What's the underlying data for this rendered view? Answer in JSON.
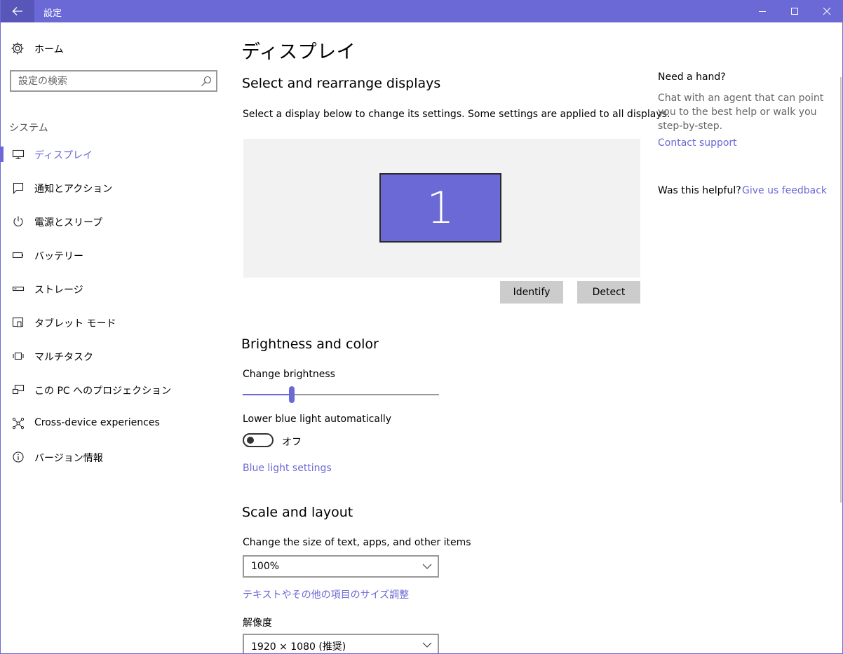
{
  "titlebar": {
    "title": "設定"
  },
  "sidebar": {
    "home_label": "ホーム",
    "search_placeholder": "設定の検索",
    "section_label": "システム",
    "items": [
      {
        "label": "ディスプレイ",
        "icon": "monitor-icon",
        "active": true
      },
      {
        "label": "通知とアクション",
        "icon": "message-icon",
        "active": false
      },
      {
        "label": "電源とスリープ",
        "icon": "power-icon",
        "active": false
      },
      {
        "label": "バッテリー",
        "icon": "battery-icon",
        "active": false
      },
      {
        "label": "ストレージ",
        "icon": "storage-icon",
        "active": false
      },
      {
        "label": "タブレット モード",
        "icon": "tablet-icon",
        "active": false
      },
      {
        "label": "マルチタスク",
        "icon": "multitask-icon",
        "active": false
      },
      {
        "label": "この PC へのプロジェクション",
        "icon": "projection-icon",
        "active": false
      },
      {
        "label": "Cross-device experiences",
        "icon": "cross-device-icon",
        "active": false
      },
      {
        "label": "バージョン情報",
        "icon": "info-icon",
        "active": false
      }
    ]
  },
  "main": {
    "page_title": "ディスプレイ",
    "arrange": {
      "heading": "Select and rearrange displays",
      "description": "Select a display below to change its settings. Some settings are applied to all displays.",
      "monitor_number": "1",
      "identify_label": "Identify",
      "detect_label": "Detect"
    },
    "brightness": {
      "heading": "Brightness and color",
      "change_label": "Change brightness",
      "value_percent": 25,
      "blue_light_label": "Lower blue light automatically",
      "toggle_state": "オフ",
      "blue_light_link": "Blue light settings"
    },
    "scale": {
      "heading": "Scale and layout",
      "size_label": "Change the size of text, apps, and other items",
      "size_value": "100%",
      "custom_link": "テキストやその他の項目のサイズ調整",
      "resolution_label": "解像度",
      "resolution_value": "1920 × 1080 (推奨)"
    }
  },
  "help": {
    "heading": "Need a hand?",
    "description": "Chat with an agent that can point you to the best help or walk you step-by-step.",
    "contact_link": "Contact support",
    "helpful_label": "Was this helpful?",
    "feedback_link": "Give us feedback"
  },
  "colors": {
    "accent": "#6b69d6",
    "title_bar": "#6b69d6",
    "button": "#cccccc",
    "display_area": "#f2f2f2"
  }
}
